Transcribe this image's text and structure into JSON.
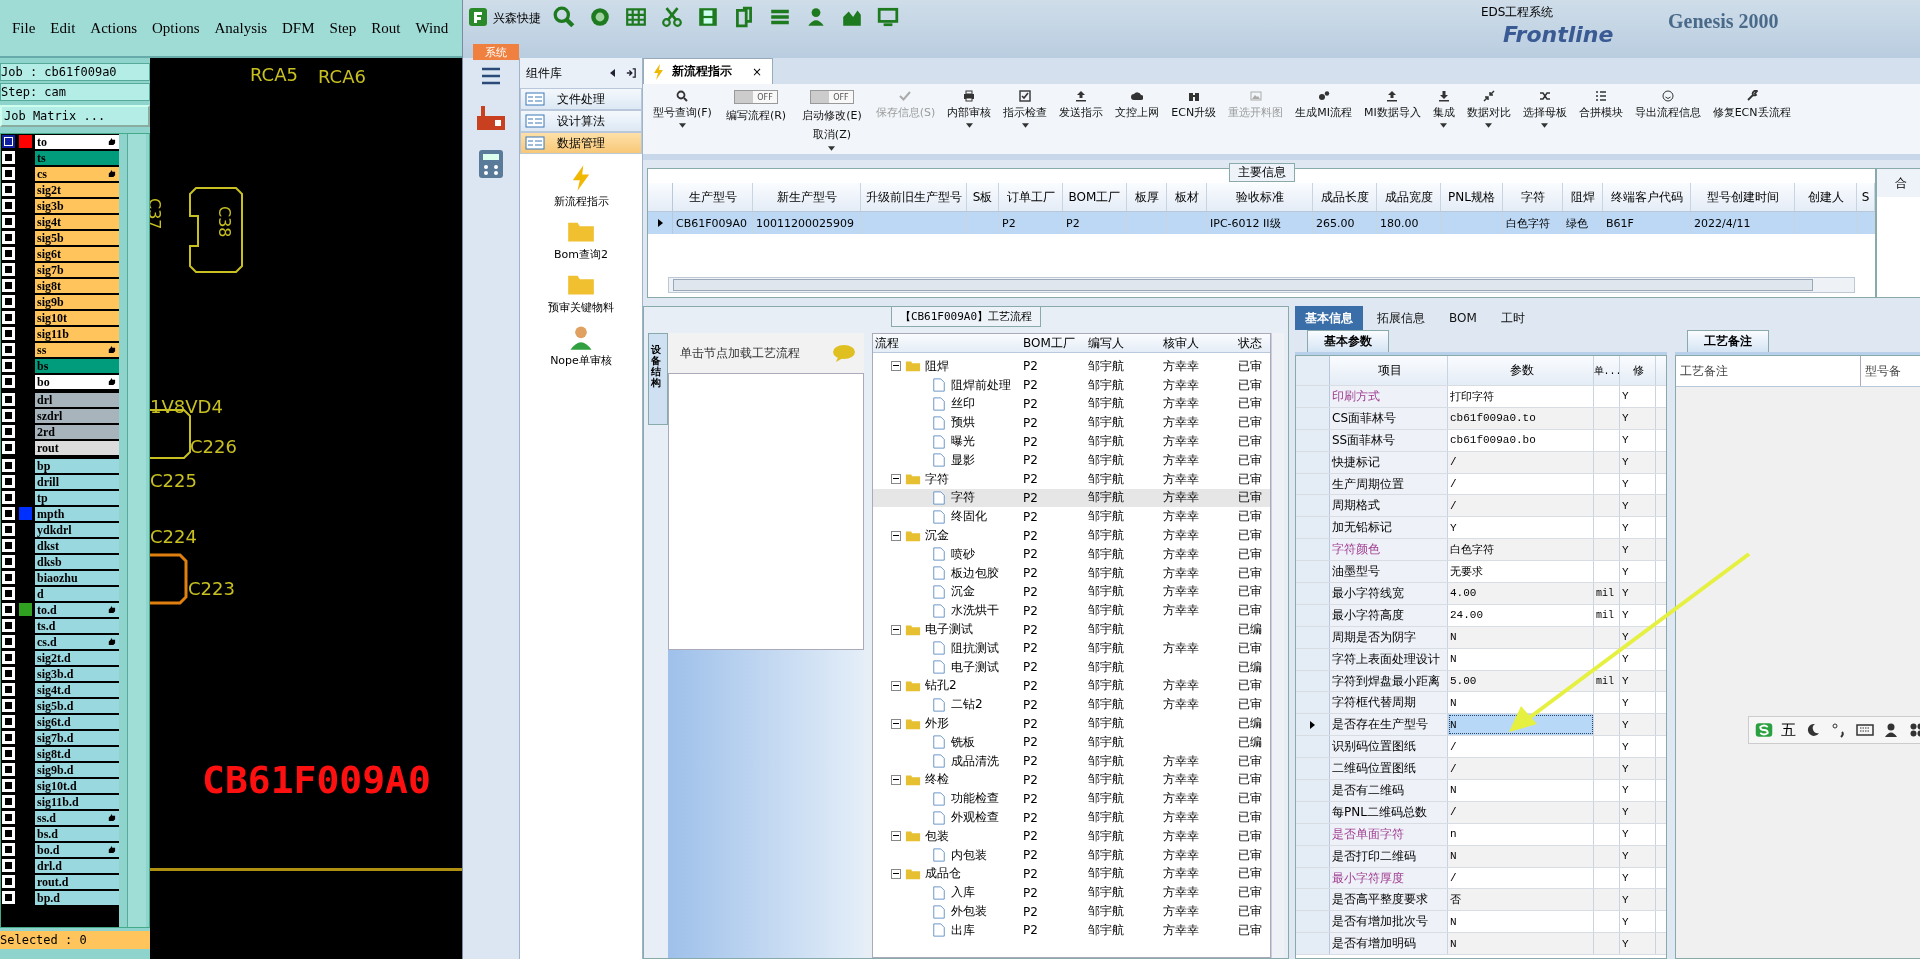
{
  "cam": {
    "menu": [
      "File",
      "Edit",
      "Actions",
      "Options",
      "Analysis",
      "DFM",
      "Step",
      "Rout",
      "Wind"
    ],
    "job": "Job : cb61f009a0",
    "step": "Step: cam",
    "job_matrix": "Job Matrix ...",
    "layer_groups": [
      [
        {
          "name": "to",
          "color": "#ffffff",
          "swatch": {
            "color": "#ff0000"
          },
          "hand": true,
          "selected": true
        },
        {
          "name": "ts",
          "color": "#009c7c",
          "hand": false,
          "selected": false
        },
        {
          "name": "cs",
          "color": "#ffc45c",
          "hand": true,
          "selected": false
        },
        {
          "name": "sig2t",
          "color": "#ffc45c",
          "hand": false,
          "selected": false
        },
        {
          "name": "sig3b",
          "color": "#ffc45c",
          "hand": false,
          "selected": false
        },
        {
          "name": "sig4t",
          "color": "#ffc45c",
          "hand": false,
          "selected": false
        },
        {
          "name": "sig5b",
          "color": "#ffc45c",
          "hand": false,
          "selected": false
        },
        {
          "name": "sig6t",
          "color": "#ffc45c",
          "hand": false,
          "selected": false
        },
        {
          "name": "sig7b",
          "color": "#ffc45c",
          "hand": false,
          "selected": false
        },
        {
          "name": "sig8t",
          "color": "#ffc45c",
          "hand": false,
          "selected": false
        },
        {
          "name": "sig9b",
          "color": "#ffc45c",
          "hand": false,
          "selected": false
        },
        {
          "name": "sig10t",
          "color": "#ffc45c",
          "hand": false,
          "selected": false
        },
        {
          "name": "sig11b",
          "color": "#ffc45c",
          "hand": false,
          "selected": false
        },
        {
          "name": "ss",
          "color": "#ffc45c",
          "hand": true,
          "selected": false
        },
        {
          "name": "bs",
          "color": "#009c7c",
          "hand": false,
          "selected": false
        },
        {
          "name": "bo",
          "color": "#ffffff",
          "hand": true,
          "selected": false
        }
      ],
      [
        {
          "name": "drl",
          "color": "#a8b4bc",
          "hand": false,
          "selected": false
        },
        {
          "name": "szdrl",
          "color": "#a8b4bc",
          "hand": false,
          "selected": false
        },
        {
          "name": "2rd",
          "color": "#a8b4bc",
          "hand": false,
          "selected": false
        },
        {
          "name": "rout",
          "color": "#dcdcdc",
          "hand": false,
          "selected": false
        }
      ],
      [
        {
          "name": "bp",
          "color": "#9ad8e0",
          "hand": false,
          "selected": false
        },
        {
          "name": "drill",
          "color": "#9ad8e0",
          "hand": false,
          "selected": false
        },
        {
          "name": "tp",
          "color": "#9ad8e0",
          "hand": false,
          "selected": false
        },
        {
          "name": "mpth",
          "color": "#9ad8e0",
          "swatch": {
            "color": "#0030ff"
          },
          "hand": false,
          "selected": false
        },
        {
          "name": "ydkdrl",
          "color": "#9ad8e0",
          "hand": false,
          "selected": false
        },
        {
          "name": "dkst",
          "color": "#9ad8e0",
          "hand": false,
          "selected": false
        },
        {
          "name": "dksb",
          "color": "#9ad8e0",
          "hand": false,
          "selected": false
        },
        {
          "name": "biaozhu",
          "color": "#9ad8e0",
          "hand": false,
          "selected": false
        },
        {
          "name": "d",
          "color": "#9ad8e0",
          "hand": false,
          "selected": false
        },
        {
          "name": "to.d",
          "color": "#9ad8e0",
          "swatch": {
            "color": "#30a020"
          },
          "hand": true,
          "selected": false
        },
        {
          "name": "ts.d",
          "color": "#9ad8e0",
          "hand": false,
          "selected": false
        },
        {
          "name": "cs.d",
          "color": "#9ad8e0",
          "hand": true,
          "selected": false
        },
        {
          "name": "sig2t.d",
          "color": "#9ad8e0",
          "hand": false,
          "selected": false
        },
        {
          "name": "sig3b.d",
          "color": "#9ad8e0",
          "hand": false,
          "selected": false
        },
        {
          "name": "sig4t.d",
          "color": "#9ad8e0",
          "hand": false,
          "selected": false
        },
        {
          "name": "sig5b.d",
          "color": "#9ad8e0",
          "hand": false,
          "selected": false
        },
        {
          "name": "sig6t.d",
          "color": "#9ad8e0",
          "hand": false,
          "selected": false
        },
        {
          "name": "sig7b.d",
          "color": "#9ad8e0",
          "hand": false,
          "selected": false
        },
        {
          "name": "sig8t.d",
          "color": "#9ad8e0",
          "hand": false,
          "selected": false
        },
        {
          "name": "sig9b.d",
          "color": "#9ad8e0",
          "hand": false,
          "selected": false
        },
        {
          "name": "sig10t.d",
          "color": "#9ad8e0",
          "hand": false,
          "selected": false
        },
        {
          "name": "sig11b.d",
          "color": "#9ad8e0",
          "hand": false,
          "selected": false
        },
        {
          "name": "ss.d",
          "color": "#9ad8e0",
          "hand": true,
          "selected": false
        },
        {
          "name": "bs.d",
          "color": "#9ad8e0",
          "hand": false,
          "selected": false
        },
        {
          "name": "bo.d",
          "color": "#9ad8e0",
          "hand": true,
          "selected": false
        },
        {
          "name": "drl.d",
          "color": "#9ad8e0",
          "hand": false,
          "selected": false
        },
        {
          "name": "rout.d",
          "color": "#9ad8e0",
          "hand": false,
          "selected": false
        },
        {
          "name": "bp.d",
          "color": "#9ad8e0",
          "hand": false,
          "selected": false
        }
      ]
    ],
    "selected_status": "Selected : 0",
    "canvas_labels": [
      {
        "text": "RCA5",
        "kind": "ref"
      },
      {
        "text": "RCA6",
        "kind": "ref"
      },
      {
        "text": "C37",
        "kind": "vertical"
      },
      {
        "text": "C38",
        "kind": "vertical"
      },
      {
        "text": "1V8VD4",
        "kind": "ref"
      },
      {
        "text": "C226",
        "kind": "ref"
      },
      {
        "text": "C225",
        "kind": "ref"
      },
      {
        "text": "C224",
        "kind": "ref"
      },
      {
        "text": "C223",
        "kind": "ref"
      },
      {
        "text": "CB61F009A0",
        "kind": "marking"
      }
    ]
  },
  "eds": {
    "quick_access": "兴森快捷",
    "title": "EDS工程系统",
    "background_titles": [
      "Frontline",
      "Genesis 2000"
    ],
    "system_tab": "系统",
    "component_library": {
      "title": "组件库",
      "items": [
        {
          "label": "文件处理",
          "selected": false
        },
        {
          "label": "设计算法",
          "selected": false
        },
        {
          "label": "数据管理",
          "selected": true
        }
      ],
      "modules": [
        "新流程指示",
        "Bom查询2",
        "预审关键物料",
        "Nope单审核"
      ]
    },
    "doc_tab": {
      "label": "新流程指示",
      "close": "×"
    },
    "ribbon": [
      {
        "kind": "button",
        "label": "型号查询(F)",
        "disabled": false,
        "dropdown": true
      },
      {
        "kind": "toggle",
        "label": "编写流程(R)",
        "state": "OFF",
        "dropdown": false
      },
      {
        "kind": "toggle",
        "label": "启动修改(E)",
        "label2": "取消(Z)",
        "state": "OFF",
        "dropdown": true
      },
      {
        "kind": "button",
        "label": "保存信息(S)",
        "disabled": true,
        "dropdown": false
      },
      {
        "kind": "button",
        "label": "内部审核",
        "disabled": false,
        "dropdown": true
      },
      {
        "kind": "button",
        "label": "指示检查",
        "disabled": false,
        "dropdown": true
      },
      {
        "kind": "button",
        "label": "发送指示",
        "disabled": false,
        "dropdown": false
      },
      {
        "kind": "button",
        "label": "文控上网",
        "disabled": false,
        "dropdown": false
      },
      {
        "kind": "button",
        "label": "ECN升级",
        "disabled": false,
        "dropdown": false
      },
      {
        "kind": "button",
        "label": "重选开料图",
        "disabled": true,
        "dropdown": false
      },
      {
        "kind": "button",
        "label": "生成MI流程",
        "disabled": false,
        "dropdown": false
      },
      {
        "kind": "button",
        "label": "MI数据导入",
        "disabled": false,
        "dropdown": false
      },
      {
        "kind": "button",
        "label": "集成",
        "disabled": false,
        "dropdown": true
      },
      {
        "kind": "button",
        "label": "数据对比",
        "disabled": false,
        "dropdown": true
      },
      {
        "kind": "button",
        "label": "选择母板",
        "disabled": false,
        "dropdown": true
      },
      {
        "kind": "button",
        "label": "合拼模块",
        "disabled": false,
        "dropdown": false
      },
      {
        "kind": "button",
        "label": "导出流程信息",
        "disabled": false,
        "dropdown": false
      },
      {
        "kind": "button",
        "label": "修复ECN丢流程",
        "disabled": false,
        "dropdown": false
      }
    ],
    "main_info": {
      "title": "主要信息",
      "columns": [
        "生产型号",
        "新生产型号",
        "升级前旧生产型号",
        "S板",
        "订单工厂",
        "BOM工厂",
        "板厚",
        "板材",
        "验收标准",
        "成品长度",
        "成品宽度",
        "PNL规格",
        "字符",
        "阻焊",
        "终端客户代码",
        "型号创建时间",
        "创建人",
        "S"
      ],
      "rows": [
        {
          "selected": true,
          "cells": [
            "CB61F009A0",
            "10011200025909",
            null,
            null,
            "P2",
            "P2",
            null,
            null,
            "IPC-6012 II级",
            "265.00",
            "180.00",
            null,
            "白色字符",
            "绿色",
            "B61F",
            "2022/4/11",
            null,
            null
          ]
        }
      ],
      "side_title": "合"
    },
    "process": {
      "title": "【CB61F009A0】工艺流程",
      "side_tab": "设备结构",
      "hint": "单击节点加载工艺流程",
      "columns": [
        "流程",
        "BOM工厂",
        "编写人",
        "核审人",
        "状态"
      ],
      "tree": [
        {
          "label": "阻焊",
          "bom": "P2",
          "writer": "邹宇航",
          "reviewer": "方幸幸",
          "status": "已审",
          "expanded": true,
          "selected": false,
          "children": [
            {
              "label": "阻焊前处理",
              "bom": "P2",
              "writer": "邹宇航",
              "reviewer": "方幸幸",
              "status": "已审",
              "selected": false
            },
            {
              "label": "丝印",
              "bom": "P2",
              "writer": "邹宇航",
              "reviewer": "方幸幸",
              "status": "已审",
              "selected": false
            },
            {
              "label": "预烘",
              "bom": "P2",
              "writer": "邹宇航",
              "reviewer": "方幸幸",
              "status": "已审",
              "selected": false
            },
            {
              "label": "曝光",
              "bom": "P2",
              "writer": "邹宇航",
              "reviewer": "方幸幸",
              "status": "已审",
              "selected": false
            },
            {
              "label": "显影",
              "bom": "P2",
              "writer": "邹宇航",
              "reviewer": "方幸幸",
              "status": "已审",
              "selected": false
            }
          ]
        },
        {
          "label": "字符",
          "bom": "P2",
          "writer": "邹宇航",
          "reviewer": "方幸幸",
          "status": "已审",
          "expanded": true,
          "selected": false,
          "children": [
            {
              "label": "字符",
              "bom": "P2",
              "writer": "邹宇航",
              "reviewer": "方幸幸",
              "status": "已审",
              "selected": true
            },
            {
              "label": "终固化",
              "bom": "P2",
              "writer": "邹宇航",
              "reviewer": "方幸幸",
              "status": "已审",
              "selected": false
            }
          ]
        },
        {
          "label": "沉金",
          "bom": "P2",
          "writer": "邹宇航",
          "reviewer": "方幸幸",
          "status": "已审",
          "expanded": true,
          "selected": false,
          "children": [
            {
              "label": "喷砂",
              "bom": "P2",
              "writer": "邹宇航",
              "reviewer": "方幸幸",
              "status": "已审",
              "selected": false
            },
            {
              "label": "板边包胶",
              "bom": "P2",
              "writer": "邹宇航",
              "reviewer": "方幸幸",
              "status": "已审",
              "selected": false
            },
            {
              "label": "沉金",
              "bom": "P2",
              "writer": "邹宇航",
              "reviewer": "方幸幸",
              "status": "已审",
              "selected": false
            },
            {
              "label": "水洗烘干",
              "bom": "P2",
              "writer": "邹宇航",
              "reviewer": "方幸幸",
              "status": "已审",
              "selected": false
            }
          ]
        },
        {
          "label": "电子测试",
          "bom": "P2",
          "writer": "邹宇航",
          "status": "已编",
          "expanded": true,
          "selected": false,
          "children": [
            {
              "label": "阻抗测试",
              "bom": "P2",
              "writer": "邹宇航",
              "reviewer": "方幸幸",
              "status": "已审",
              "selected": false
            },
            {
              "label": "电子测试",
              "bom": "P2",
              "writer": "邹宇航",
              "status": "已编",
              "selected": false
            }
          ]
        },
        {
          "label": "钻孔2",
          "bom": "P2",
          "writer": "邹宇航",
          "reviewer": "方幸幸",
          "status": "已审",
          "expanded": true,
          "selected": false,
          "children": [
            {
              "label": "二钻2",
              "bom": "P2",
              "writer": "邹宇航",
              "reviewer": "方幸幸",
              "status": "已审",
              "selected": false
            }
          ]
        },
        {
          "label": "外形",
          "bom": "P2",
          "writer": "邹宇航",
          "status": "已编",
          "expanded": true,
          "selected": false,
          "children": [
            {
              "label": "铣板",
              "bom": "P2",
              "writer": "邹宇航",
              "status": "已编",
              "selected": false
            },
            {
              "label": "成品清洗",
              "bom": "P2",
              "writer": "邹宇航",
              "reviewer": "方幸幸",
              "status": "已审",
              "selected": false
            }
          ]
        },
        {
          "label": "终检",
          "bom": "P2",
          "writer": "邹宇航",
          "reviewer": "方幸幸",
          "status": "已审",
          "expanded": true,
          "selected": false,
          "children": [
            {
              "label": "功能检查",
              "bom": "P2",
              "writer": "邹宇航",
              "reviewer": "方幸幸",
              "status": "已审",
              "selected": false
            },
            {
              "label": "外观检查",
              "bom": "P2",
              "writer": "邹宇航",
              "reviewer": "方幸幸",
              "status": "已审",
              "selected": false
            }
          ]
        },
        {
          "label": "包装",
          "bom": "P2",
          "writer": "邹宇航",
          "reviewer": "方幸幸",
          "status": "已审",
          "expanded": true,
          "selected": false,
          "children": [
            {
              "label": "内包装",
              "bom": "P2",
              "writer": "邹宇航",
              "reviewer": "方幸幸",
              "status": "已审",
              "selected": false
            }
          ]
        },
        {
          "label": "成品仓",
          "bom": "P2",
          "writer": "邹宇航",
          "reviewer": "方幸幸",
          "status": "已审",
          "expanded": true,
          "selected": false,
          "children": [
            {
              "label": "入库",
              "bom": "P2",
              "writer": "邹宇航",
              "reviewer": "方幸幸",
              "status": "已审",
              "selected": false
            },
            {
              "label": "外包装",
              "bom": "P2",
              "writer": "邹宇航",
              "reviewer": "方幸幸",
              "status": "已审",
              "selected": false
            },
            {
              "label": "出库",
              "bom": "P2",
              "writer": "邹宇航",
              "reviewer": "方幸幸",
              "status": "已审",
              "selected": false
            }
          ]
        }
      ]
    },
    "detail_tabs": [
      {
        "label": "基本信息",
        "selected": true
      },
      {
        "label": "拓展信息",
        "selected": false
      },
      {
        "label": "BOM",
        "selected": false
      },
      {
        "label": "工时",
        "selected": false
      }
    ],
    "params": {
      "title": "基本参数",
      "columns": [
        "项目",
        "参数",
        "单...",
        "修"
      ],
      "rows": [
        {
          "item": "印刷方式",
          "value": "打印字符",
          "modified": "Y",
          "flagged": true,
          "selected": false
        },
        {
          "item": "CS面菲林号",
          "value": "cb61f009a0.to",
          "modified": "Y",
          "flagged": false,
          "selected": false
        },
        {
          "item": "SS面菲林号",
          "value": "cb61f009a0.bo",
          "modified": "Y",
          "flagged": false,
          "selected": false
        },
        {
          "item": "快捷标记",
          "value": "/",
          "modified": "Y",
          "flagged": false,
          "selected": false
        },
        {
          "item": "生产周期位置",
          "value": "/",
          "modified": "Y",
          "flagged": false,
          "selected": false
        },
        {
          "item": "周期格式",
          "value": "/",
          "modified": "Y",
          "flagged": false,
          "selected": false
        },
        {
          "item": "加无铅标记",
          "value": "Y",
          "modified": "Y",
          "flagged": false,
          "selected": false
        },
        {
          "item": "字符颜色",
          "value": "白色字符",
          "modified": "Y",
          "flagged": true,
          "selected": false
        },
        {
          "item": "油墨型号",
          "value": "无要求",
          "modified": "Y",
          "flagged": false,
          "selected": false
        },
        {
          "item": "最小字符线宽",
          "value": "4.00",
          "unit": "mil",
          "modified": "Y",
          "flagged": false,
          "selected": false
        },
        {
          "item": "最小字符高度",
          "value": "24.00",
          "unit": "mil",
          "modified": "Y",
          "flagged": false,
          "selected": false
        },
        {
          "item": "周期是否为阴字",
          "value": "N",
          "modified": "Y",
          "flagged": false,
          "selected": false
        },
        {
          "item": "字符上表面处理设计",
          "value": "N",
          "modified": "Y",
          "flagged": false,
          "selected": false
        },
        {
          "item": "字符到焊盘最小距离",
          "value": "5.00",
          "unit": "mil",
          "modified": "Y",
          "flagged": false,
          "selected": false
        },
        {
          "item": "字符框代替周期",
          "value": "N",
          "modified": "Y",
          "flagged": false,
          "selected": false
        },
        {
          "item": "是否存在生产型号",
          "value": "N",
          "modified": "Y",
          "flagged": false,
          "selected": true
        },
        {
          "item": "识别码位置图纸",
          "value": "/",
          "modified": "Y",
          "flagged": false,
          "selected": false
        },
        {
          "item": "二维码位置图纸",
          "value": "/",
          "modified": "Y",
          "flagged": false,
          "selected": false
        },
        {
          "item": "是否有二维码",
          "value": "N",
          "modified": "Y",
          "flagged": false,
          "selected": false
        },
        {
          "item": "每PNL二维码总数",
          "value": "/",
          "modified": "Y",
          "flagged": false,
          "selected": false
        },
        {
          "item": "是否单面字符",
          "value": "n",
          "modified": "Y",
          "flagged": true,
          "selected": false
        },
        {
          "item": "是否打印二维码",
          "value": "N",
          "modified": "Y",
          "flagged": false,
          "selected": false
        },
        {
          "item": "最小字符厚度",
          "value": "/",
          "modified": "Y",
          "flagged": true,
          "selected": false
        },
        {
          "item": "是否高平整度要求",
          "value": "否",
          "modified": "Y",
          "flagged": false,
          "selected": false
        },
        {
          "item": "是否有增加批次号",
          "value": "N",
          "modified": "Y",
          "flagged": false,
          "selected": false
        },
        {
          "item": "是否有增加明码",
          "value": "N",
          "modified": "Y",
          "flagged": false,
          "selected": false
        }
      ]
    },
    "remarks": {
      "title": "工艺备注",
      "columns": [
        "工艺备注",
        "型号备"
      ]
    },
    "ime": {
      "mode": "五"
    }
  }
}
